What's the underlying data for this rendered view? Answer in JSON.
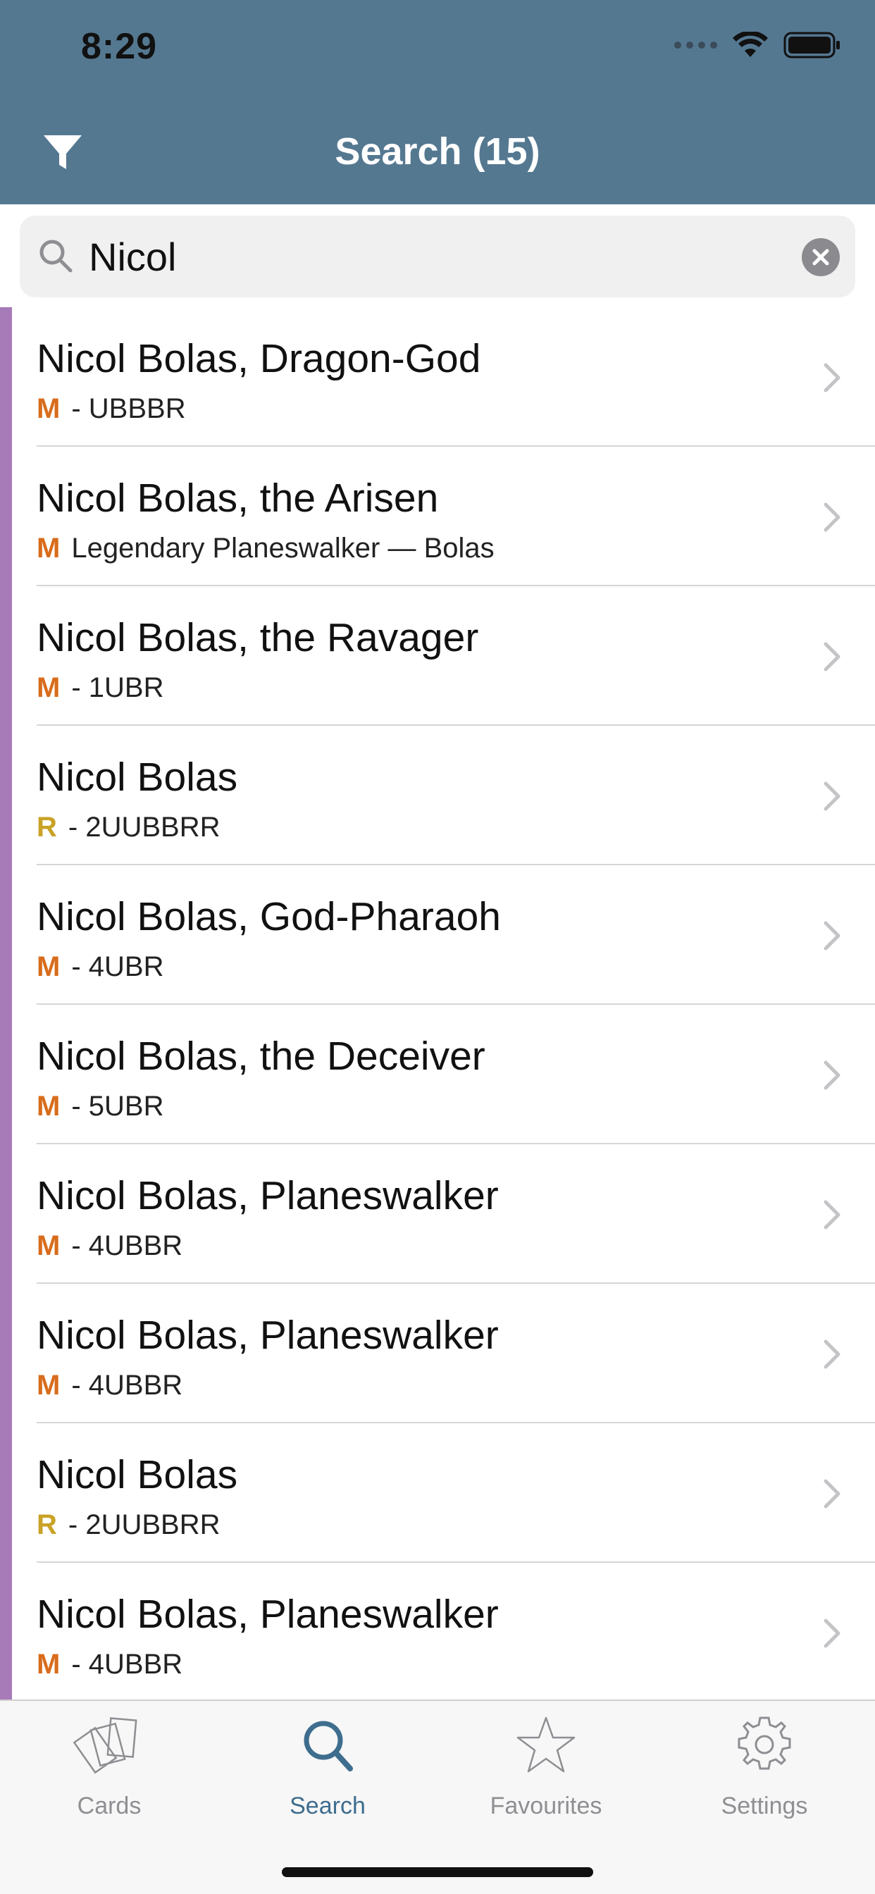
{
  "status_bar": {
    "time": "8:29"
  },
  "header": {
    "title": "Search (15)"
  },
  "search": {
    "value": "Nicol"
  },
  "colors": {
    "header_bg": "#557891",
    "mythic": "#d86c1c",
    "rare": "#c9a227",
    "side_bar": "#a77ab8",
    "active_tab": "#3e6d8e"
  },
  "results": [
    {
      "name": "Nicol Bolas, Dragon-God",
      "rarity": "M",
      "detail": "- UBBBR"
    },
    {
      "name": "Nicol Bolas, the Arisen",
      "rarity": "M",
      "detail": "Legendary Planeswalker — Bolas"
    },
    {
      "name": "Nicol Bolas, the Ravager",
      "rarity": "M",
      "detail": "- 1UBR"
    },
    {
      "name": "Nicol Bolas",
      "rarity": "R",
      "detail": "- 2UUBBRR"
    },
    {
      "name": "Nicol Bolas, God-Pharaoh",
      "rarity": "M",
      "detail": "- 4UBR"
    },
    {
      "name": "Nicol Bolas, the Deceiver",
      "rarity": "M",
      "detail": "- 5UBR"
    },
    {
      "name": "Nicol Bolas, Planeswalker",
      "rarity": "M",
      "detail": "- 4UBBR"
    },
    {
      "name": "Nicol Bolas, Planeswalker",
      "rarity": "M",
      "detail": "- 4UBBR"
    },
    {
      "name": "Nicol Bolas",
      "rarity": "R",
      "detail": "- 2UUBBRR"
    },
    {
      "name": "Nicol Bolas, Planeswalker",
      "rarity": "M",
      "detail": "- 4UBBR"
    }
  ],
  "tabs": [
    {
      "label": "Cards",
      "icon": "cards-icon"
    },
    {
      "label": "Search",
      "icon": "search-icon"
    },
    {
      "label": "Favourites",
      "icon": "star-icon"
    },
    {
      "label": "Settings",
      "icon": "gear-icon"
    }
  ]
}
